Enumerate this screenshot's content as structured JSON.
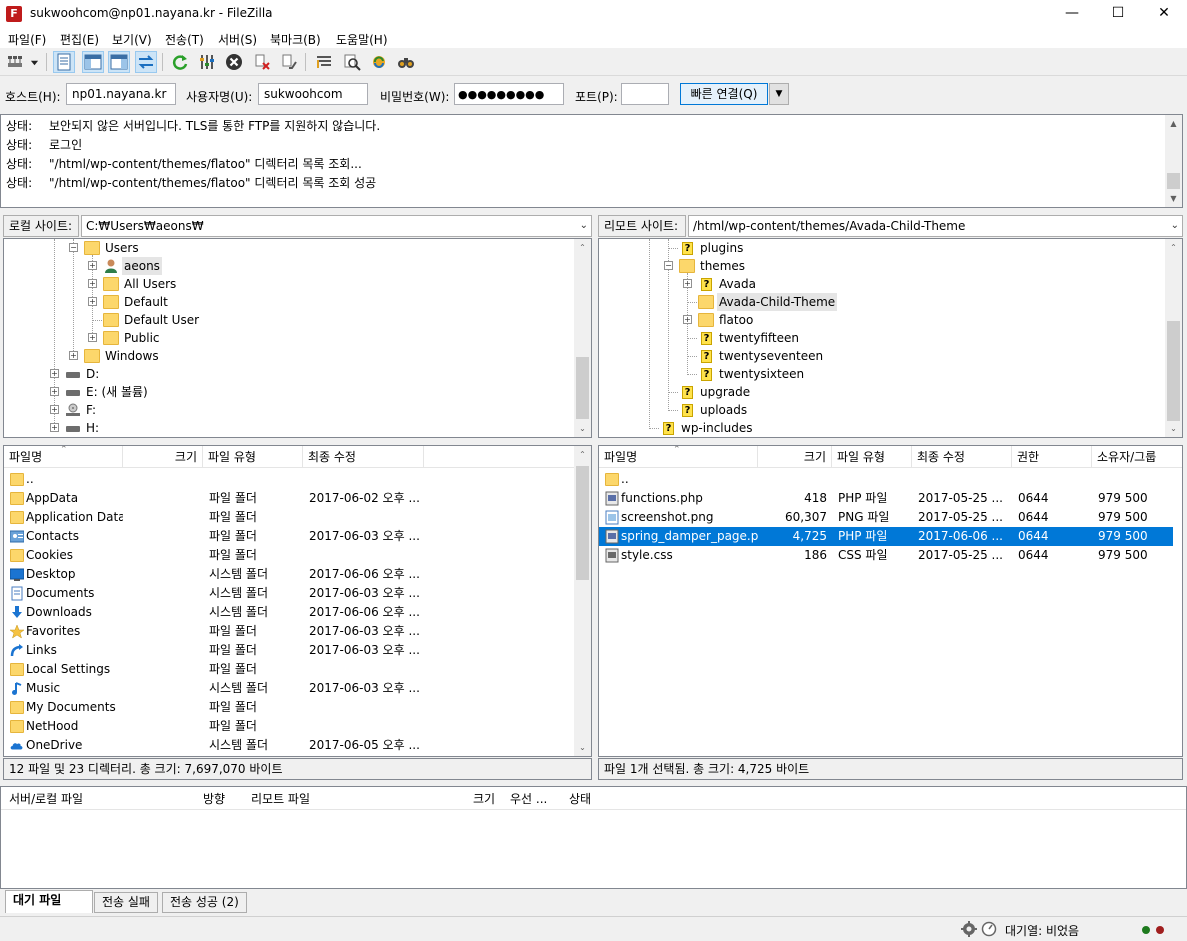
{
  "window": {
    "title": "sukwoohcom@np01.nayana.kr - FileZilla",
    "app_icon_letter": "F"
  },
  "menu": [
    "파일(F)",
    "편집(E)",
    "보기(V)",
    "전송(T)",
    "서버(S)",
    "북마크(B)",
    "도움말(H)"
  ],
  "toolbar": {
    "icons": [
      "site-manager-icon",
      "dropdown-arrow-icon",
      "toggle-log-icon",
      "toggle-local-tree-icon",
      "toggle-remote-tree-icon",
      "toggle-queue-icon",
      "refresh-icon",
      "process-queue-icon",
      "cancel-icon",
      "disconnect-icon",
      "reconnect-icon",
      "filter-icon",
      "search-files-icon",
      "sync-browse-icon",
      "compare-icon"
    ]
  },
  "quickconnect": {
    "host_label": "호스트(H):",
    "host_value": "np01.nayana.kr",
    "user_label": "사용자명(U):",
    "user_value": "sukwoohcom",
    "pass_label": "비밀번호(W):",
    "pass_value": "●●●●●●●●●",
    "port_label": "포트(P):",
    "port_value": "",
    "connect_label": "빠른 연결(Q)"
  },
  "log": [
    {
      "key": "상태:",
      "msg": "보안되지 않은 서버입니다. TLS를 통한 FTP를 지원하지 않습니다."
    },
    {
      "key": "상태:",
      "msg": "로그인"
    },
    {
      "key": "상태:",
      "msg": "\"/html/wp-content/themes/flatoo\" 디렉터리 목록 조회..."
    },
    {
      "key": "상태:",
      "msg": "\"/html/wp-content/themes/flatoo\" 디렉터리 목록 조회 성공"
    }
  ],
  "local": {
    "path_label": "로컬 사이트:",
    "path": "C:₩Users₩aeons₩",
    "tree": [
      {
        "label": "Users",
        "icon": "folder"
      },
      {
        "label": "aeons",
        "icon": "user"
      },
      {
        "label": "All Users",
        "icon": "folder"
      },
      {
        "label": "Default",
        "icon": "folder"
      },
      {
        "label": "Default User",
        "icon": "folder"
      },
      {
        "label": "Public",
        "icon": "folder"
      },
      {
        "label": "Windows",
        "icon": "folder"
      },
      {
        "label": "D:",
        "icon": "drive"
      },
      {
        "label": "E: (새 볼륨)",
        "icon": "drive"
      },
      {
        "label": "F:",
        "icon": "cdrom"
      },
      {
        "label": "H:",
        "icon": "drive"
      }
    ],
    "columns": [
      "파일명",
      "크기",
      "파일 유형",
      "최종 수정"
    ],
    "files": [
      {
        "name": "..",
        "size": "",
        "type": "",
        "modified": "",
        "icon": "folder"
      },
      {
        "name": "AppData",
        "size": "",
        "type": "파일 폴더",
        "modified": "2017-06-02 오후 ...",
        "icon": "folder"
      },
      {
        "name": "Application Data",
        "size": "",
        "type": "파일 폴더",
        "modified": "",
        "icon": "folder"
      },
      {
        "name": "Contacts",
        "size": "",
        "type": "파일 폴더",
        "modified": "2017-06-03 오후 ...",
        "icon": "contacts"
      },
      {
        "name": "Cookies",
        "size": "",
        "type": "파일 폴더",
        "modified": "",
        "icon": "folder"
      },
      {
        "name": "Desktop",
        "size": "",
        "type": "시스템 폴더",
        "modified": "2017-06-06 오후 ...",
        "icon": "desktop"
      },
      {
        "name": "Documents",
        "size": "",
        "type": "시스템 폴더",
        "modified": "2017-06-03 오후 ...",
        "icon": "documents"
      },
      {
        "name": "Downloads",
        "size": "",
        "type": "시스템 폴더",
        "modified": "2017-06-06 오후 ...",
        "icon": "downloads"
      },
      {
        "name": "Favorites",
        "size": "",
        "type": "파일 폴더",
        "modified": "2017-06-03 오후 ...",
        "icon": "favorites"
      },
      {
        "name": "Links",
        "size": "",
        "type": "파일 폴더",
        "modified": "2017-06-03 오후 ...",
        "icon": "links"
      },
      {
        "name": "Local Settings",
        "size": "",
        "type": "파일 폴더",
        "modified": "",
        "icon": "folder"
      },
      {
        "name": "Music",
        "size": "",
        "type": "시스템 폴더",
        "modified": "2017-06-03 오후 ...",
        "icon": "music"
      },
      {
        "name": "My Documents",
        "size": "",
        "type": "파일 폴더",
        "modified": "",
        "icon": "folder"
      },
      {
        "name": "NetHood",
        "size": "",
        "type": "파일 폴더",
        "modified": "",
        "icon": "folder"
      },
      {
        "name": "OneDrive",
        "size": "",
        "type": "시스템 폴더",
        "modified": "2017-06-05 오후 ...",
        "icon": "onedrive"
      }
    ],
    "status": "12 파일 및 23 디렉터리. 총 크기: 7,697,070 바이트"
  },
  "remote": {
    "path_label": "리모트 사이트:",
    "path": "/html/wp-content/themes/Avada-Child-Theme",
    "tree": [
      {
        "label": "plugins",
        "icon": "unknown"
      },
      {
        "label": "themes",
        "icon": "folder"
      },
      {
        "label": "Avada",
        "icon": "unknown"
      },
      {
        "label": "Avada-Child-Theme",
        "icon": "folder"
      },
      {
        "label": "flatoo",
        "icon": "folder"
      },
      {
        "label": "twentyfifteen",
        "icon": "unknown"
      },
      {
        "label": "twentyseventeen",
        "icon": "unknown"
      },
      {
        "label": "twentysixteen",
        "icon": "unknown"
      },
      {
        "label": "upgrade",
        "icon": "unknown"
      },
      {
        "label": "uploads",
        "icon": "unknown"
      },
      {
        "label": "wp-includes",
        "icon": "unknown"
      }
    ],
    "columns": [
      "파일명",
      "크기",
      "파일 유형",
      "최종 수정",
      "권한",
      "소유자/그룹"
    ],
    "files": [
      {
        "name": "..",
        "size": "",
        "type": "",
        "modified": "",
        "perm": "",
        "owner": "",
        "icon": "folder"
      },
      {
        "name": "functions.php",
        "size": "418",
        "type": "PHP 파일",
        "modified": "2017-05-25 ...",
        "perm": "0644",
        "owner": "979 500",
        "icon": "php"
      },
      {
        "name": "screenshot.png",
        "size": "60,307",
        "type": "PNG 파일",
        "modified": "2017-05-25 ...",
        "perm": "0644",
        "owner": "979 500",
        "icon": "png"
      },
      {
        "name": "spring_damper_page.php",
        "size": "4,725",
        "type": "PHP 파일",
        "modified": "2017-06-06 ...",
        "perm": "0644",
        "owner": "979 500",
        "icon": "php",
        "selected": true
      },
      {
        "name": "style.css",
        "size": "186",
        "type": "CSS 파일",
        "modified": "2017-05-25 ...",
        "perm": "0644",
        "owner": "979 500",
        "icon": "css"
      }
    ],
    "status": "파일 1개 선택됨. 총 크기: 4,725 바이트"
  },
  "queue": {
    "columns": [
      "서버/로컬 파일",
      "방향",
      "리모트 파일",
      "크기",
      "우선 ...",
      "상태"
    ]
  },
  "tabs": [
    "대기 파일",
    "전송 실패",
    "전송 성공 (2)"
  ],
  "statusbar": {
    "queue_text": "대기열: 비었음"
  }
}
